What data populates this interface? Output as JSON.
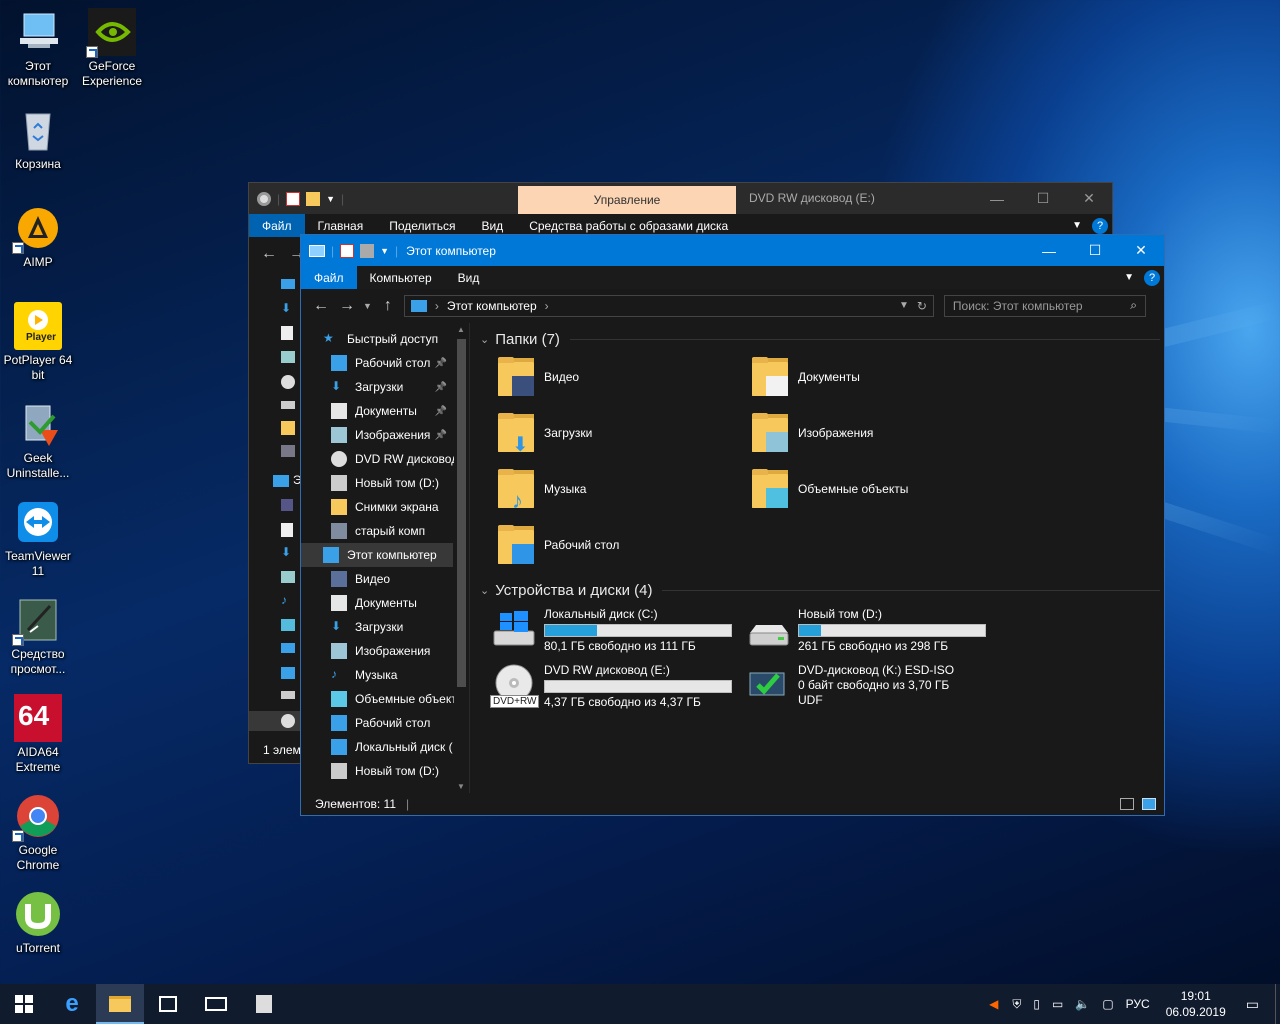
{
  "desktop": {
    "icons": [
      {
        "label": "Этот компьютер"
      },
      {
        "label": "GeForce Experience"
      },
      {
        "label": "Корзина"
      },
      {
        "label": "AIMP"
      },
      {
        "label": "PotPlayer 64 bit",
        "logo_text": "Player"
      },
      {
        "label": "Geek Uninstalle..."
      },
      {
        "label": "TeamViewer 11"
      },
      {
        "label": "Средство просмот..."
      },
      {
        "label": "AIDA64 Extreme",
        "logo_text": "64"
      },
      {
        "label": "Google Chrome"
      },
      {
        "label": "uTorrent"
      }
    ]
  },
  "back_window": {
    "context_tab": "Управление",
    "title": "DVD RW дисковод (E:)",
    "tabs": [
      "Файл",
      "Главная",
      "Поделиться",
      "Вид",
      "Средства работы с образами диска"
    ],
    "nav_partial": "Э",
    "status": "1 элем"
  },
  "front_window": {
    "title": "Этот компьютер",
    "tabs": [
      "Файл",
      "Компьютер",
      "Вид"
    ],
    "address": "Этот компьютер",
    "search_placeholder": "Поиск: Этот компьютер",
    "nav": [
      {
        "label": "Быстрый доступ",
        "icon": "star-icon",
        "pinned": false
      },
      {
        "label": "Рабочий стол",
        "icon": "desktop-icon",
        "pinned": true
      },
      {
        "label": "Загрузки",
        "icon": "download-icon",
        "pinned": true
      },
      {
        "label": "Документы",
        "icon": "document-icon",
        "pinned": true
      },
      {
        "label": "Изображения",
        "icon": "picture-icon",
        "pinned": true
      },
      {
        "label": "DVD RW дисковод",
        "icon": "dvd-icon",
        "pinned": false
      },
      {
        "label": "Новый том (D:)",
        "icon": "drive-icon",
        "pinned": false
      },
      {
        "label": "Снимки экрана",
        "icon": "folder-icon",
        "pinned": false
      },
      {
        "label": "старый комп",
        "icon": "network-icon",
        "pinned": false
      },
      {
        "label": "Этот компьютер",
        "icon": "computer-icon",
        "pinned": false
      },
      {
        "label": "Видео",
        "icon": "video-icon",
        "pinned": false
      },
      {
        "label": "Документы",
        "icon": "document-icon",
        "pinned": false
      },
      {
        "label": "Загрузки",
        "icon": "download-icon",
        "pinned": false
      },
      {
        "label": "Изображения",
        "icon": "picture-icon",
        "pinned": false
      },
      {
        "label": "Музыка",
        "icon": "music-icon",
        "pinned": false
      },
      {
        "label": "Объемные объекты",
        "icon": "3d-objects-icon",
        "pinned": false
      },
      {
        "label": "Рабочий стол",
        "icon": "desktop-icon",
        "pinned": false
      },
      {
        "label": "Локальный диск (",
        "icon": "windows-drive-icon",
        "pinned": false
      },
      {
        "label": "Новый том (D:)",
        "icon": "drive-icon",
        "pinned": false
      }
    ],
    "folders_header": "Папки (7)",
    "folders": [
      "Видео",
      "Документы",
      "Загрузки",
      "Изображения",
      "Музыка",
      "Объемные объекты",
      "Рабочий стол"
    ],
    "devices_header": "Устройства и диски (4)",
    "drives": [
      {
        "name": "Локальный диск (C:)",
        "free": "80,1 ГБ свободно из 111 ГБ",
        "used_fraction": 0.28
      },
      {
        "name": "Новый том (D:)",
        "free": "261 ГБ свободно из 298 ГБ",
        "used_fraction": 0.12
      },
      {
        "name": "DVD RW дисковод (E:)",
        "free": "4,37 ГБ свободно из 4,37 ГБ",
        "used_fraction": 0,
        "badge": "DVD+RW"
      },
      {
        "name": "DVD-дисковод (K:) ESD-ISO",
        "free": "0 байт свободно из 3,70 ГБ",
        "extra": "UDF"
      }
    ],
    "status": "Элементов: 11"
  },
  "taskbar": {
    "lang": "РУС",
    "time": "19:01",
    "date": "06.09.2019"
  },
  "colors": {
    "accent": "#0078d7",
    "dark": "#191919",
    "bar": "#26a0da",
    "folder": "#f7c95c"
  }
}
